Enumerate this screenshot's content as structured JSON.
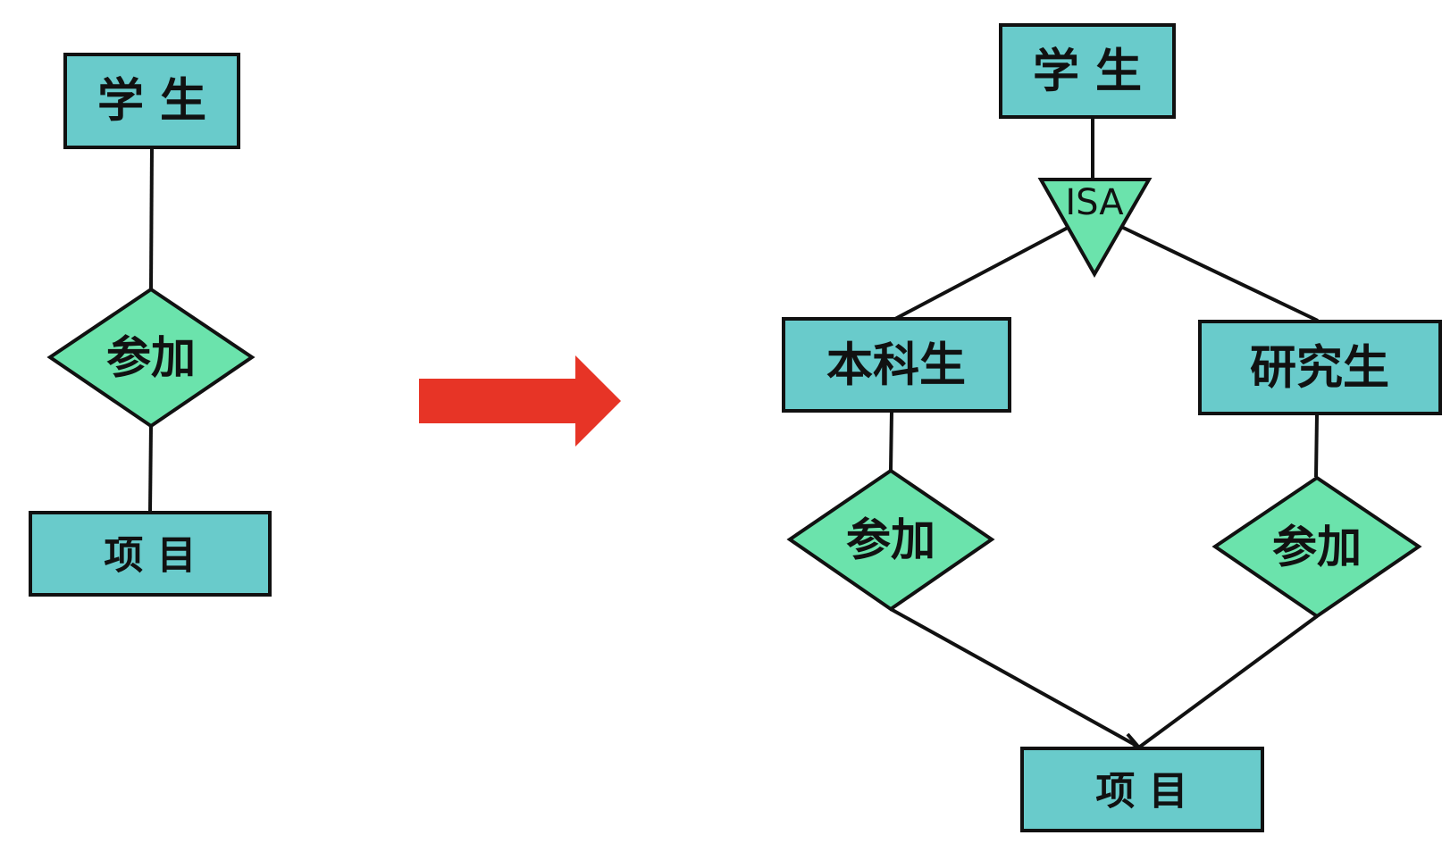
{
  "colors": {
    "entity_fill": "#69cbcb",
    "relationship_fill": "#6be3ac",
    "isa_fill": "#6be3ac",
    "arrow_fill": "#e73426",
    "stroke": "#111111"
  },
  "left": {
    "entity_top": "学 生",
    "relationship": "参加",
    "entity_bottom": "项 目"
  },
  "right": {
    "entity_top": "学 生",
    "isa": "ISA",
    "entity_left": "本科生",
    "entity_right": "研究生",
    "relationship_left": "参加",
    "relationship_right": "参加",
    "entity_bottom": "项 目"
  },
  "icons": {
    "transform_arrow": "right-arrow-icon"
  }
}
